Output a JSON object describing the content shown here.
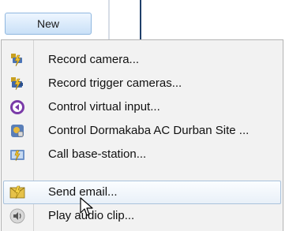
{
  "toolbar": {
    "new_label": "New"
  },
  "menu": {
    "items": [
      {
        "label": "Record camera...",
        "icon": "record-camera-icon"
      },
      {
        "label": "Record trigger cameras...",
        "icon": "record-trigger-cameras-icon"
      },
      {
        "label": "Control virtual input...",
        "icon": "control-virtual-input-icon"
      },
      {
        "label": "Control Dormakaba AC Durban Site ...",
        "icon": "access-control-icon"
      },
      {
        "label": "Call base-station...",
        "icon": "base-station-icon"
      },
      {
        "label": "Send email...",
        "icon": "send-email-icon",
        "highlighted": true
      },
      {
        "label": "Play audio clip...",
        "icon": "speaker-icon"
      }
    ]
  }
}
